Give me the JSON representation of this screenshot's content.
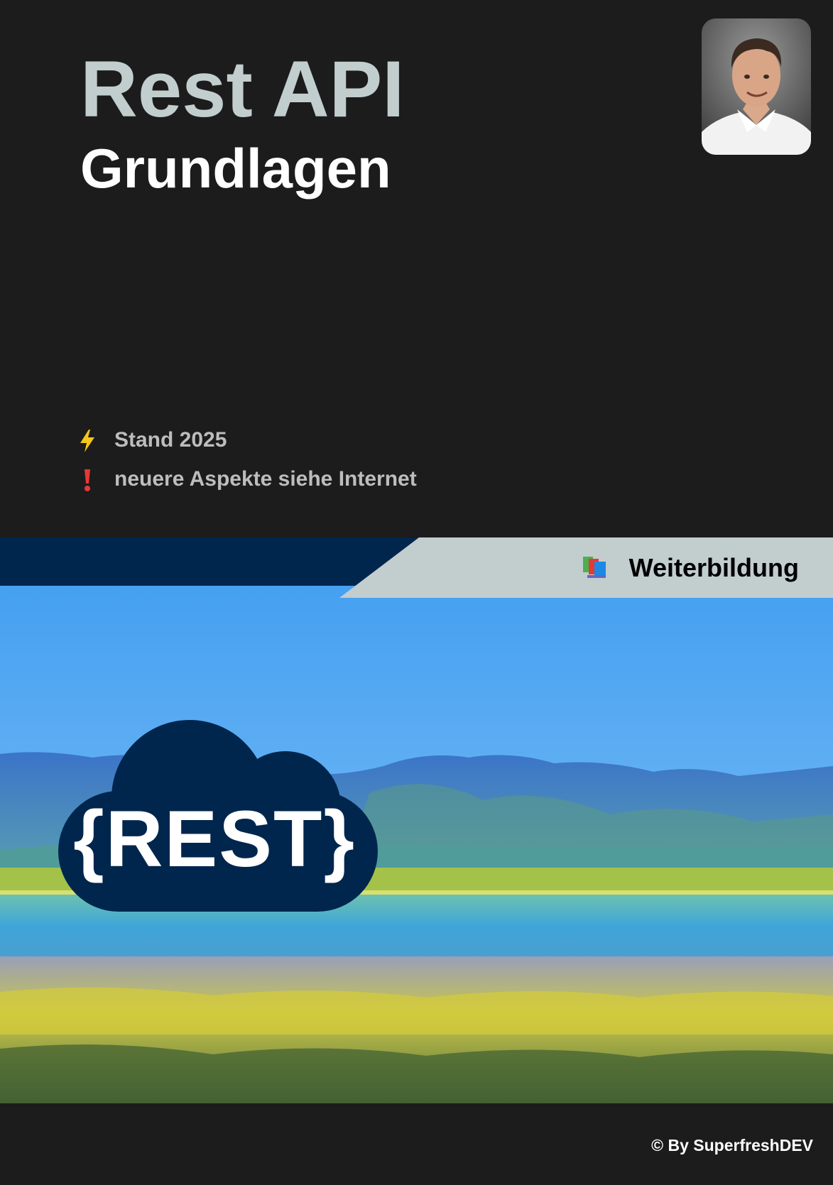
{
  "header": {
    "title": "Rest API",
    "subtitle": "Grundlagen"
  },
  "author": {
    "avatar_icon": "author-portrait"
  },
  "notes": [
    {
      "icon": "lightning-icon",
      "color": "#f5c518",
      "text": "Stand 2025"
    },
    {
      "icon": "exclamation-icon",
      "color": "#e53935",
      "text": "neuere Aspekte siehe Internet"
    }
  ],
  "banner": {
    "category_icon": "books-icon",
    "category": "Weiterbildung",
    "logo_text": "{REST}",
    "logo_color": "#00264d"
  },
  "footer": {
    "credit": "© By SuperfreshDEV"
  },
  "colors": {
    "background": "#1c1c1c",
    "title": "#c2cdce",
    "ribbon_dark": "#00264d",
    "ribbon_light": "#c2cdce"
  }
}
